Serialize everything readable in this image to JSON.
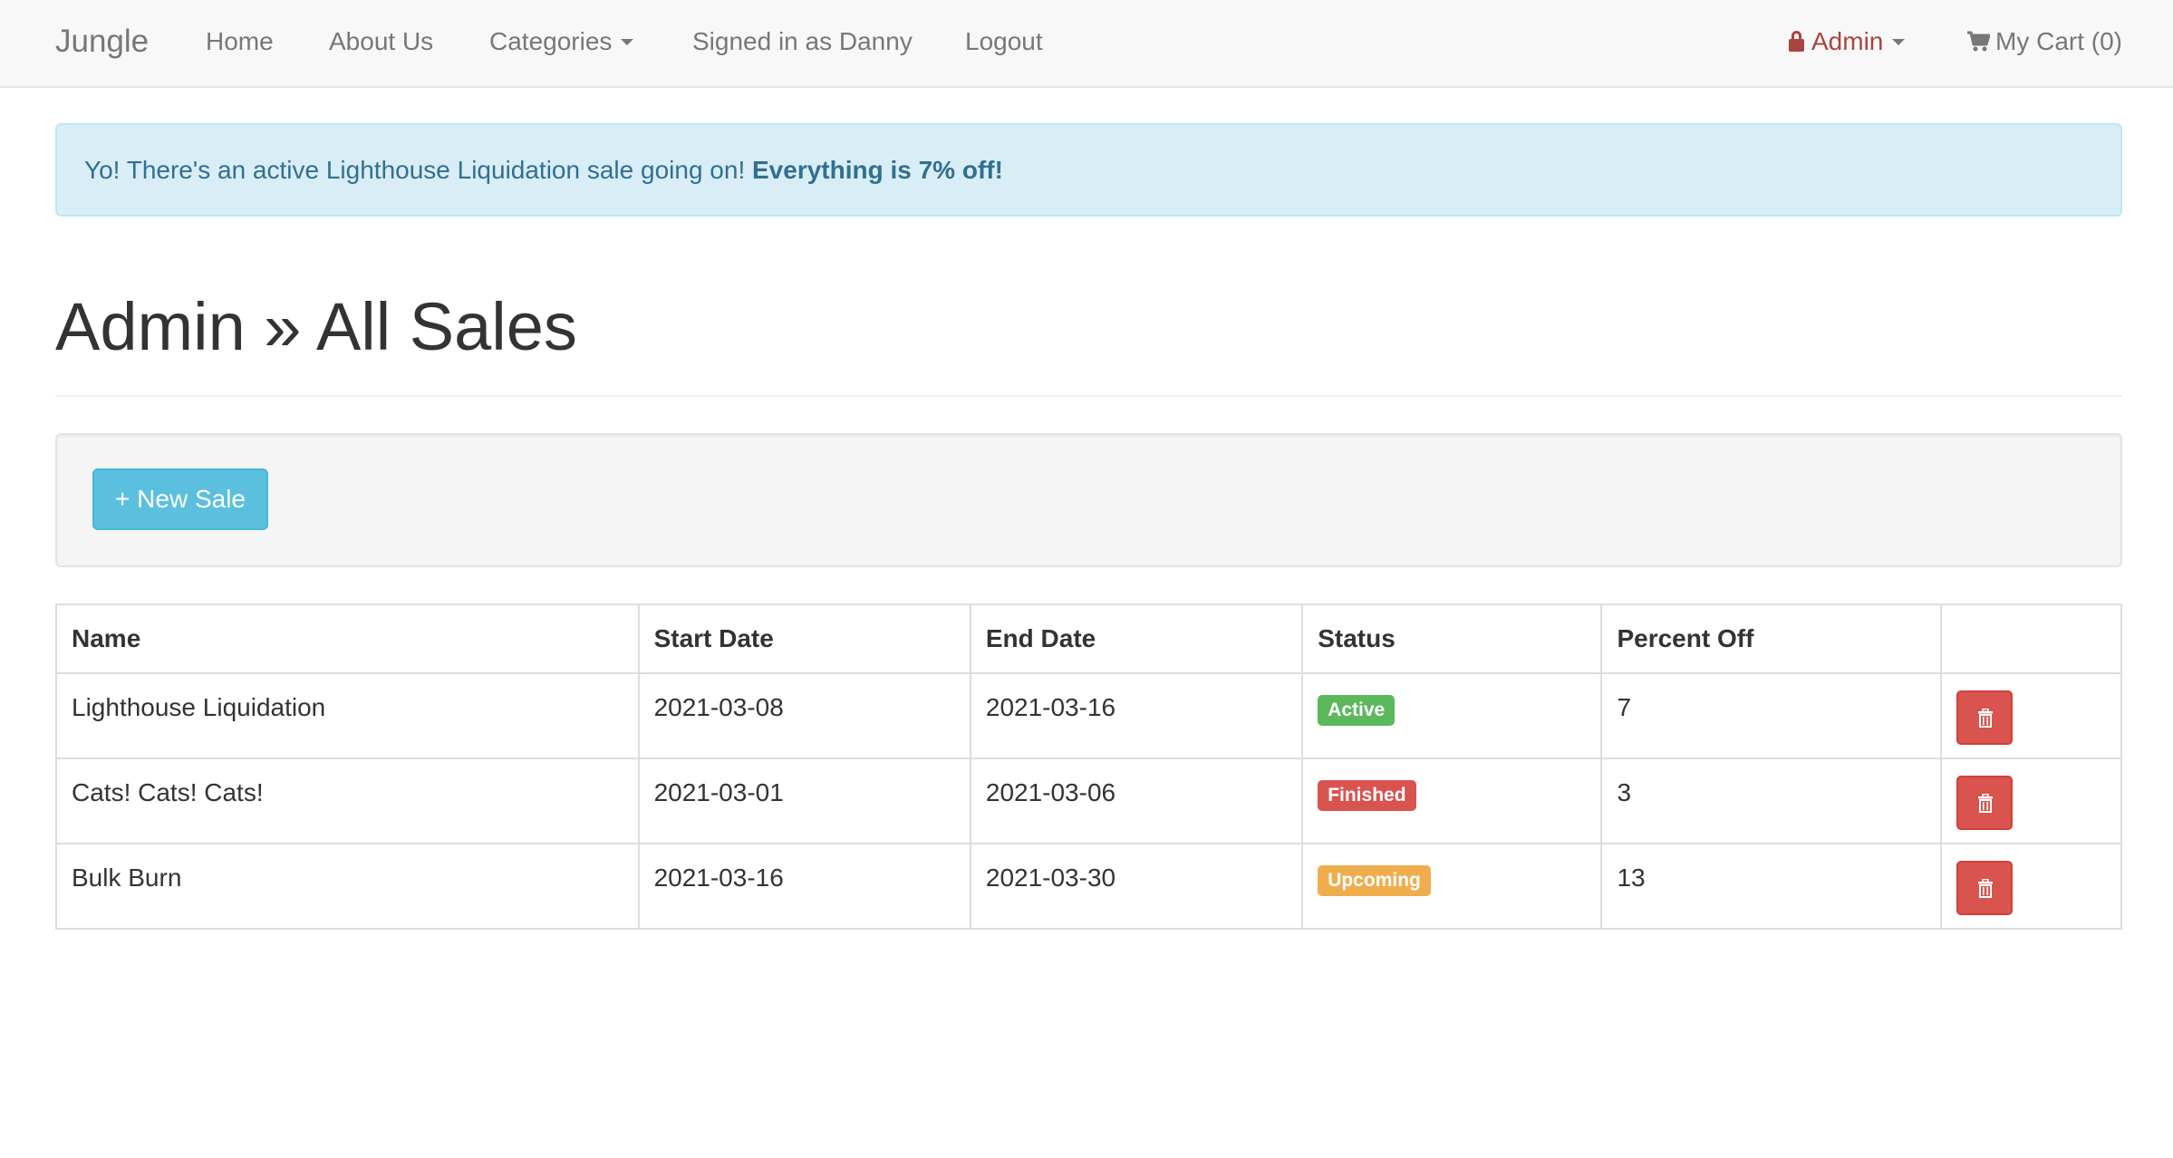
{
  "navbar": {
    "brand": "Jungle",
    "links": {
      "home": "Home",
      "about": "About Us",
      "categories": "Categories",
      "signed_in": "Signed in as Danny",
      "logout": "Logout",
      "admin": "Admin",
      "cart": "My Cart (0)"
    },
    "icons": {
      "admin": "lock-icon",
      "cart": "shopping-cart-icon",
      "dropdown": "caret-down-icon"
    }
  },
  "alert": {
    "text": "Yo! There's an active Lighthouse Liquidation sale going on!",
    "emphasis": "Everything is 7% off!"
  },
  "page": {
    "title": "Admin » All Sales"
  },
  "actions": {
    "new_sale": "+ New Sale"
  },
  "table": {
    "headers": {
      "name": "Name",
      "start": "Start Date",
      "end": "End Date",
      "status": "Status",
      "percent": "Percent Off"
    },
    "rows": [
      {
        "name": "Lighthouse Liquidation",
        "start": "2021-03-08",
        "end": "2021-03-16",
        "status": "Active",
        "percent": "7"
      },
      {
        "name": "Cats! Cats! Cats!",
        "start": "2021-03-01",
        "end": "2021-03-06",
        "status": "Finished",
        "percent": "3"
      },
      {
        "name": "Bulk Burn",
        "start": "2021-03-16",
        "end": "2021-03-30",
        "status": "Upcoming",
        "percent": "13"
      }
    ]
  },
  "colors": {
    "status_active": "#5cb85c",
    "status_finished": "#d9534f",
    "status_upcoming": "#f0ad4e",
    "admin_link": "#a94442",
    "new_sale_button": "#5bc0de",
    "delete_button": "#d9534f"
  }
}
